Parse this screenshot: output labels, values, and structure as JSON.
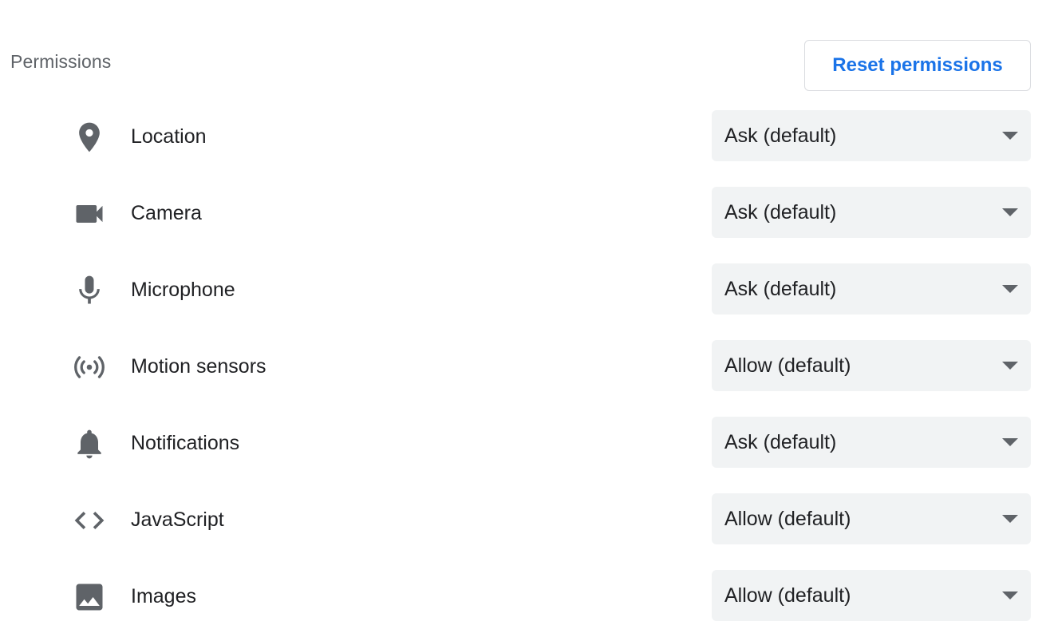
{
  "section": {
    "title": "Permissions",
    "reset_label": "Reset permissions"
  },
  "colors": {
    "accent": "#1a73e8",
    "icon": "#5f6368",
    "select_bg": "#f1f3f4",
    "text": "#202124"
  },
  "permissions": [
    {
      "icon": "location-pin-icon",
      "label": "Location",
      "value": "Ask (default)"
    },
    {
      "icon": "camera-icon",
      "label": "Camera",
      "value": "Ask (default)"
    },
    {
      "icon": "microphone-icon",
      "label": "Microphone",
      "value": "Ask (default)"
    },
    {
      "icon": "motion-sensors-icon",
      "label": "Motion sensors",
      "value": "Allow (default)"
    },
    {
      "icon": "bell-icon",
      "label": "Notifications",
      "value": "Ask (default)"
    },
    {
      "icon": "code-icon",
      "label": "JavaScript",
      "value": "Allow (default)"
    },
    {
      "icon": "image-icon",
      "label": "Images",
      "value": "Allow (default)"
    }
  ]
}
